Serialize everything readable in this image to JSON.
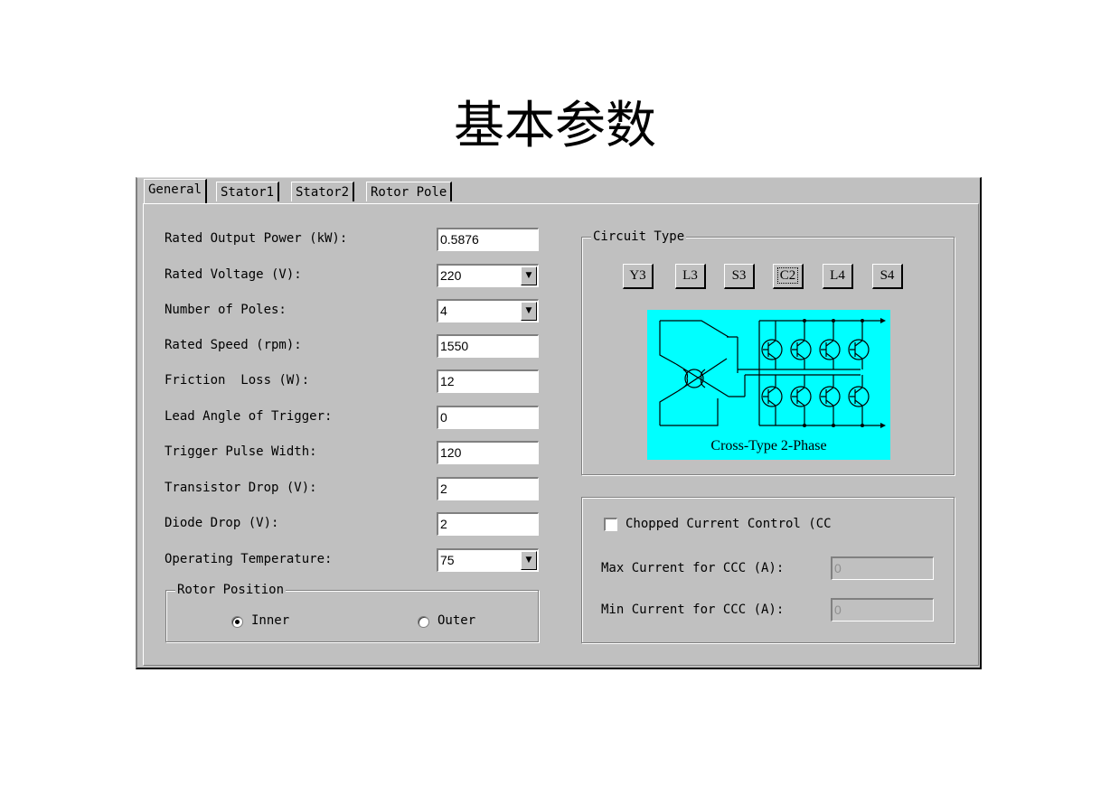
{
  "page": {
    "title": "基本参数"
  },
  "tabs": [
    {
      "label": "General",
      "active": true
    },
    {
      "label": "Stator1",
      "active": false
    },
    {
      "label": "Stator2",
      "active": false
    },
    {
      "label": "Rotor Pole",
      "active": false
    }
  ],
  "general": {
    "fields": [
      {
        "label": "Rated Output Power (kW):",
        "value": "0.5876",
        "type": "text"
      },
      {
        "label": "Rated Voltage (V):",
        "value": "220",
        "type": "combo"
      },
      {
        "label": "Number of Poles:",
        "value": "4",
        "type": "combo"
      },
      {
        "label": "Rated Speed (rpm):",
        "value": "1550",
        "type": "text"
      },
      {
        "label": "Friction  Loss (W):",
        "value": "12",
        "type": "text"
      },
      {
        "label": "Lead Angle of Trigger:",
        "value": "0",
        "type": "text"
      },
      {
        "label": "Trigger Pulse Width:",
        "value": "120",
        "type": "text"
      },
      {
        "label": "Transistor Drop (V):",
        "value": "2",
        "type": "text"
      },
      {
        "label": "Diode Drop (V):",
        "value": "2",
        "type": "text"
      },
      {
        "label": "Operating Temperature:",
        "value": "75",
        "type": "combo"
      }
    ],
    "rotor_position": {
      "caption": "Rotor Position",
      "options": [
        {
          "label": "Inner",
          "selected": true
        },
        {
          "label": "Outer",
          "selected": false
        }
      ]
    }
  },
  "circuit": {
    "caption": "Circuit Type",
    "buttons": [
      "Y3",
      "L3",
      "S3",
      "C2",
      "L4",
      "S4"
    ],
    "selected": "C2",
    "diagram_caption": "Cross-Type 2-Phase",
    "diagram_bg": "#00ffff"
  },
  "ccc": {
    "checkbox_label": "Chopped Current Control (CC",
    "checked": false,
    "max_label": "Max Current for CCC (A):",
    "max_value": "0",
    "min_label": "Min Current for CCC (A):",
    "min_value": "0"
  }
}
